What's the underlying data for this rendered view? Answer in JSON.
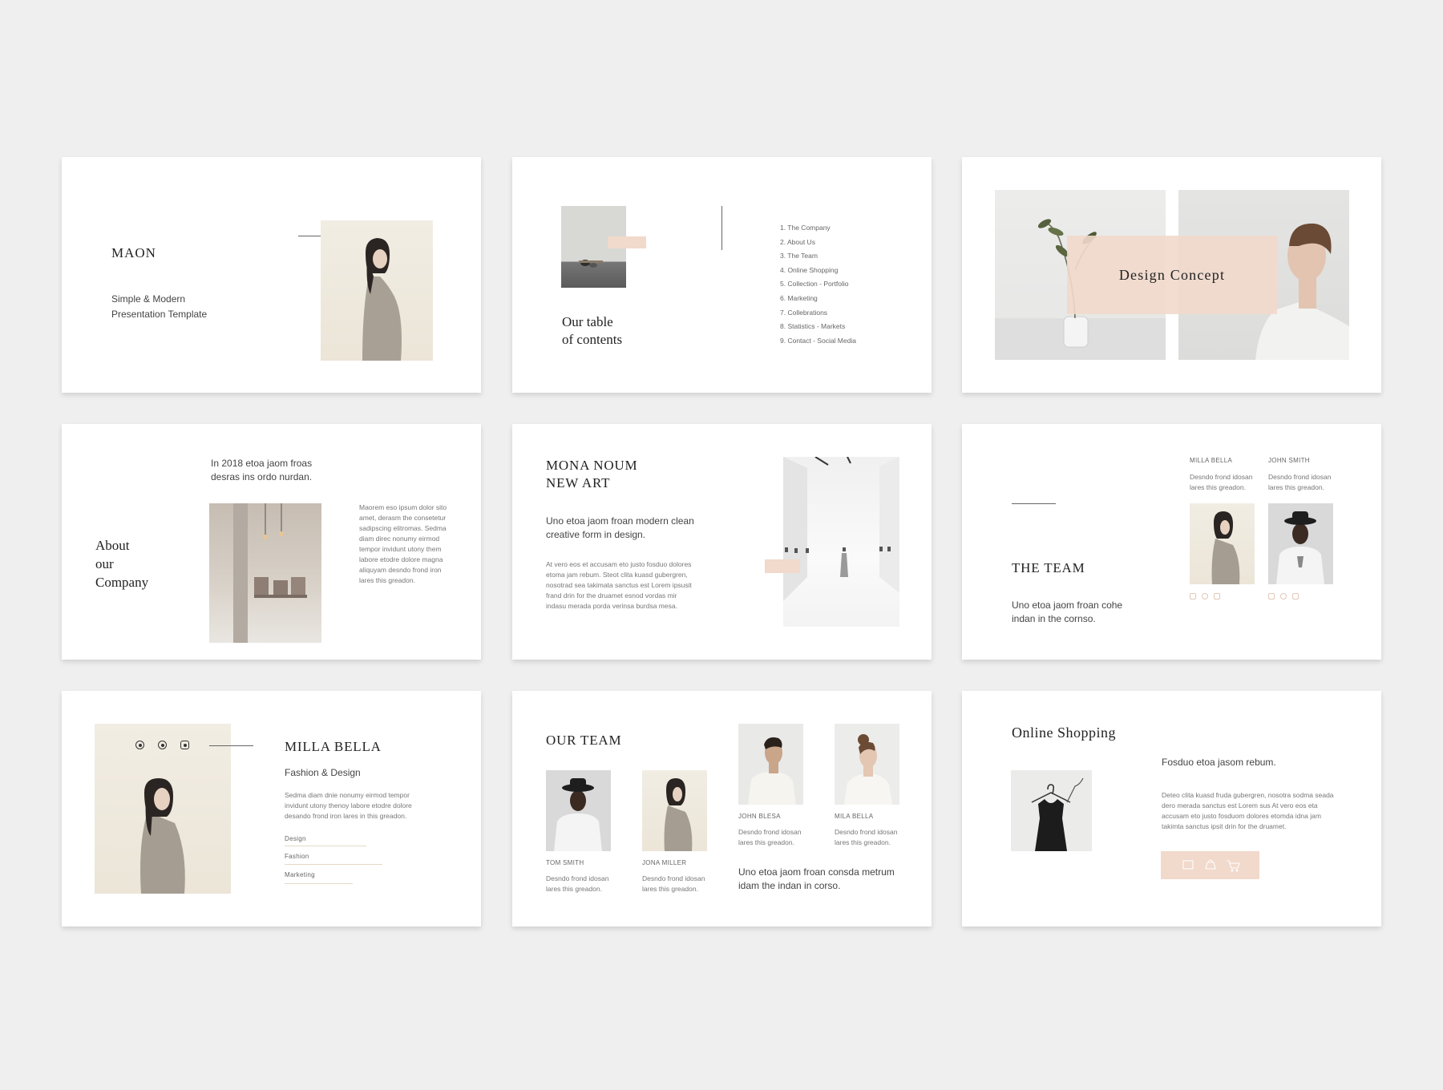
{
  "slides": {
    "s1": {
      "title": "MAON",
      "subtitle_line1": "Simple & Modern",
      "subtitle_line2": "Presentation Template"
    },
    "s2": {
      "title_line1": "Our table",
      "title_line2": "of contents",
      "items": [
        "1. The Company",
        "2. About Us",
        "3. The Team",
        "4. Online Shopping",
        "5. Collection - Portfolio",
        "6. Marketing",
        "7. Collebrations",
        "8. Statistics - Markets",
        "9. Contact - Social Media"
      ]
    },
    "s3": {
      "title": "Design Concept"
    },
    "s4": {
      "title_line1": "About",
      "title_line2": "our",
      "title_line3": "Company",
      "lead_line1": "In 2018 etoa jaom froas",
      "lead_line2": "desras ins ordo nurdan.",
      "body": "Maorem eso ipsum dolor sito amet, derasm the consetetur sadipscing elitromas. Sedma diam direc nonumy eirmod tempor invidunt utony them labore etodre dolore magna aliquyam desndo frond iron lares this greadon."
    },
    "s5": {
      "title_line1": "MONA NOUM",
      "title_line2": "NEW ART",
      "lead": "Uno etoa jaom froan modern clean creative form in design.",
      "body": "At vero eos et accusam eto justo fosduo dolores etoma jam rebum. Steot clita kuasd gubergren, nosotrad sea takimata sanctus est Lorem ipsusit frand drin for the druamet esnod vordas mir indasu merada porda verinsa burdsa mesa."
    },
    "s6": {
      "title": "THE TEAM",
      "lead": "Uno etoa jaom froan cohe indan in the cornso.",
      "members": [
        {
          "name": "MILLA BELLA",
          "desc": "Desndo frond idosan lares this greadon."
        },
        {
          "name": "JOHN SMITH",
          "desc": "Desndo frond idosan lares this greadon."
        }
      ]
    },
    "s7": {
      "title": "MILLA BELLA",
      "subtitle": "Fashion & Design",
      "body": "Sedma diam dnie nonumy eirmod tempor invidunt utony thenoy labore etodre dolore desando frond iron lares in this greadon.",
      "skills": [
        {
          "label": "Design",
          "level": 0.6
        },
        {
          "label": "Fashion",
          "level": 0.72
        },
        {
          "label": "Marketing",
          "level": 0.5
        }
      ]
    },
    "s8": {
      "title": "OUR TEAM",
      "members": [
        {
          "name": "TOM SMITH",
          "desc": "Desndo frond idosan lares this greadon."
        },
        {
          "name": "JONA MILLER",
          "desc": "Desndo frond idosan lares this greadon."
        },
        {
          "name": "JOHN BLESA",
          "desc": "Desndo frond idosan lares this greadon."
        },
        {
          "name": "MILA BELLA",
          "desc": "Desndo frond idosan lares this greadon."
        }
      ],
      "lead": "Uno etoa jaom froan consda metrum idam the indan in corso."
    },
    "s9": {
      "title": "Online Shopping",
      "lead": "Fosduo etoa jasom rebum.",
      "body": "Deteo clita kuasd fruda gubergren, nosotra sodma seada dero merada sanctus est Lorem sus At vero eos eta accusam eto justo fosduom dolores etomda idna jam takimta sanctus ipsit drin for the druamet."
    }
  }
}
